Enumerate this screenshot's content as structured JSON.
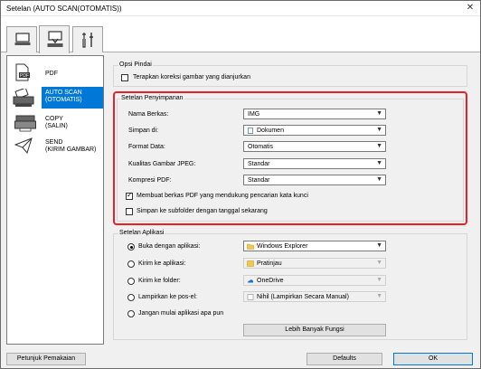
{
  "window": {
    "title": "Setelan (AUTO SCAN(OTOMATIS))",
    "close": "✕"
  },
  "tabs": [
    {
      "name": "scan-from-computer"
    },
    {
      "name": "scan-from-panel"
    },
    {
      "name": "general-settings"
    }
  ],
  "sidebar": {
    "items": [
      {
        "label": "PDF"
      },
      {
        "label": "AUTO SCAN\n(OTOMATIS)"
      },
      {
        "label": "COPY\n(SALIN)"
      },
      {
        "label": "SEND\n(KIRIM GAMBAR)"
      }
    ]
  },
  "scan_options": {
    "title": "Opsi Pindai",
    "apply_correction": {
      "label": "Terapkan koreksi gambar yang dianjurkan",
      "checked": false
    }
  },
  "save_settings": {
    "title": "Setelan Penyimpanan",
    "file_name": {
      "label": "Nama Berkas:",
      "value": "IMG"
    },
    "save_in": {
      "label": "Simpan di:",
      "value": "Dokumen"
    },
    "data_format": {
      "label": "Format Data:",
      "value": "Otomatis"
    },
    "jpeg_quality": {
      "label": "Kualitas Gambar JPEG:",
      "value": "Standar"
    },
    "pdf_compression": {
      "label": "Kompresi PDF:",
      "value": "Standar"
    },
    "keyword_pdf": {
      "label": "Membuat berkas PDF yang mendukung pencarian kata kunci",
      "checked": true
    },
    "subfolder": {
      "label": "Simpan ke subfolder dengan tanggal sekarang",
      "checked": false
    }
  },
  "app_settings": {
    "title": "Setelan Aplikasi",
    "open_with": {
      "label": "Buka dengan aplikasi:",
      "value": "Windows Explorer",
      "selected": true
    },
    "send_to_app": {
      "label": "Kirim ke aplikasi:",
      "value": "Pratinjau"
    },
    "send_to_folder": {
      "label": "Kirim ke folder:",
      "value": "OneDrive"
    },
    "attach_email": {
      "label": "Lampirkan ke pos-el:",
      "value": "Nihil (Lampirkan Secara Manual)"
    },
    "do_not_start": {
      "label": "Jangan mulai aplikasi apa pun"
    },
    "more_functions": "Lebih Banyak Fungsi"
  },
  "footer": {
    "instructions": "Petunjuk Pemakaian",
    "defaults": "Defaults",
    "ok": "OK"
  },
  "colors": {
    "accent": "#0078d7",
    "highlight_frame": "#e8202a"
  }
}
